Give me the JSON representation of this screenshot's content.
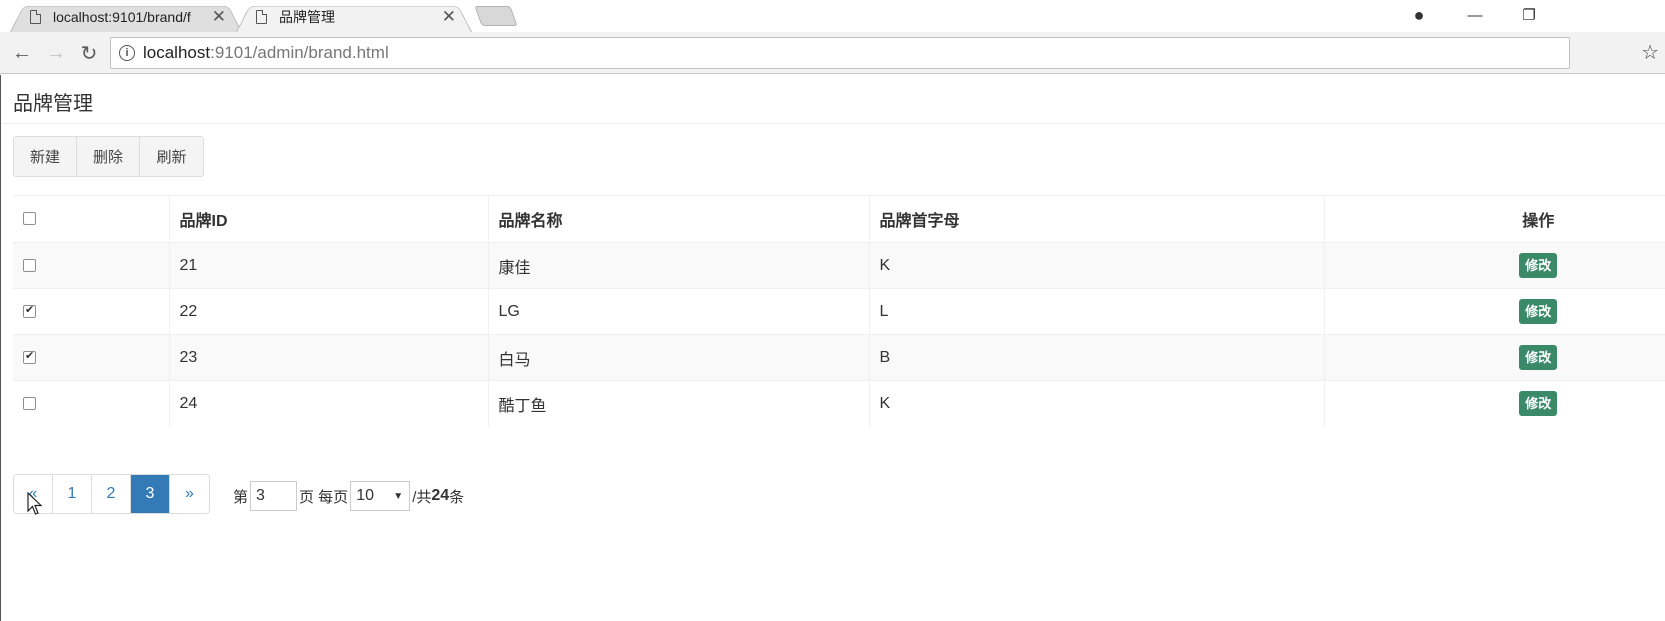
{
  "browser": {
    "tabs": [
      {
        "title": "localhost:9101/brand/f",
        "close": "✕"
      },
      {
        "title": "品牌管理",
        "close": "✕"
      }
    ],
    "url_host": "localhost",
    "url_path": ":9101/admin/brand.html",
    "icons": {
      "back": "←",
      "forward": "→",
      "reload": "↻",
      "info": "i",
      "star": "☆",
      "account": "●",
      "minimize": "—",
      "restore": "❐"
    }
  },
  "page": {
    "title": "品牌管理",
    "toolbar": {
      "new_label": "新建",
      "delete_label": "删除",
      "refresh_label": "刷新"
    },
    "table": {
      "headers": [
        "品牌ID",
        "品牌名称",
        "品牌首字母",
        "操作"
      ],
      "rows": [
        {
          "checked": false,
          "id": "21",
          "name": "康佳",
          "letter": "K",
          "action": "修改"
        },
        {
          "checked": true,
          "id": "22",
          "name": "LG",
          "letter": "L",
          "action": "修改"
        },
        {
          "checked": true,
          "id": "23",
          "name": "白马",
          "letter": "B",
          "action": "修改"
        },
        {
          "checked": false,
          "id": "24",
          "name": "酷丁鱼",
          "letter": "K",
          "action": "修改"
        }
      ]
    },
    "pagination": {
      "prev": "«",
      "pages": [
        "1",
        "2",
        "3"
      ],
      "active_page": "3",
      "next": "»",
      "prefix": "第",
      "current_page": "3",
      "page_suffix": "页 每页",
      "page_size": "10",
      "total_prefix": "/共",
      "total": "24",
      "total_suffix": "条"
    },
    "colors": {
      "accent": "#337ab7",
      "edit_button": "#3a8a6a"
    }
  }
}
